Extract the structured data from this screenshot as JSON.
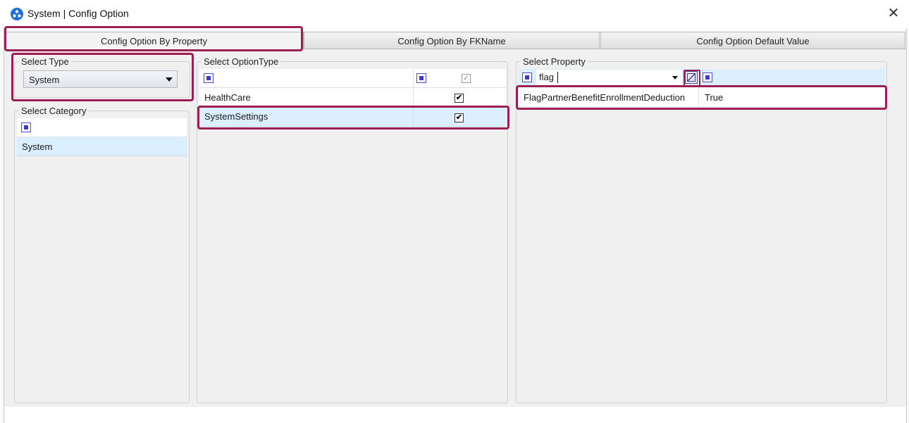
{
  "window": {
    "title": "System | Config Option",
    "close_glyph": "✕",
    "app_icon": "app-logo-icon"
  },
  "tabs": [
    {
      "label": "Config Option By Property",
      "active": true
    },
    {
      "label": "Config Option By FKName",
      "active": false
    },
    {
      "label": "Config Option Default Value",
      "active": false
    }
  ],
  "select_type": {
    "label": "Select Type",
    "value": "System"
  },
  "select_category": {
    "label": "Select Category",
    "items": [
      "System"
    ]
  },
  "select_option_type": {
    "label": "Select OptionType",
    "items": [
      {
        "name": "HealthCare",
        "checked": "✔"
      },
      {
        "name": "SystemSettings",
        "checked": "✔"
      }
    ],
    "header_check": "✓"
  },
  "select_property": {
    "label": "Select Property",
    "filter_value": "flag",
    "rows": [
      {
        "name": "FlagPartnerBenefitEnrollmentDeduction",
        "value": "True"
      }
    ]
  },
  "colors": {
    "highlight": "#9c1f54",
    "selection": "#dcefff",
    "accent": "#3a3acc"
  }
}
